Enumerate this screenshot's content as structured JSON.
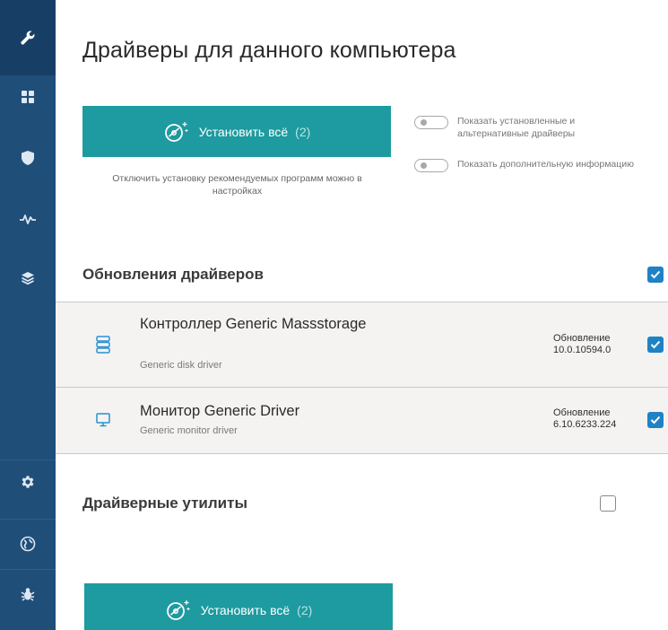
{
  "sidebar": {
    "top_items": [
      {
        "icon": "wrench-icon",
        "active": true
      },
      {
        "icon": "grid-icon",
        "active": false
      },
      {
        "icon": "shield-icon",
        "active": false
      },
      {
        "icon": "pulse-icon",
        "active": false
      },
      {
        "icon": "layers-icon",
        "active": false
      }
    ],
    "bottom_items": [
      {
        "icon": "gear-icon"
      },
      {
        "icon": "globe-icon"
      },
      {
        "icon": "bug-icon"
      }
    ]
  },
  "main": {
    "title": "Драйверы для данного компьютера",
    "install_all": {
      "label": "Установить всё",
      "count": "(2)"
    },
    "hint": "Отключить установку рекомендуемых программ можно в настройках",
    "toggles": [
      {
        "label": "Показать установленные и альтернативные драйверы",
        "on": false
      },
      {
        "label": "Показать дополнительную информацию",
        "on": false
      }
    ],
    "driver_updates": {
      "title": "Обновления драйверов",
      "checked": true,
      "items": [
        {
          "name": "Контроллер Generic Massstorage",
          "sub": "Generic disk driver",
          "update_label": "Обновление",
          "version": "10.0.10594.0",
          "icon": "storage-icon",
          "checked": true
        },
        {
          "name": "Монитор Generic Driver",
          "sub": "Generic monitor driver",
          "update_label": "Обновление",
          "version": "6.10.6233.224",
          "icon": "monitor-icon",
          "checked": true
        }
      ]
    },
    "utilities": {
      "title": "Драйверные утилиты",
      "checked": false
    },
    "colors": {
      "sidebar": "#1f4e79",
      "accent": "#1d9ba0",
      "checkbox": "#1f82c4",
      "row_bg": "#f4f3f1"
    }
  }
}
